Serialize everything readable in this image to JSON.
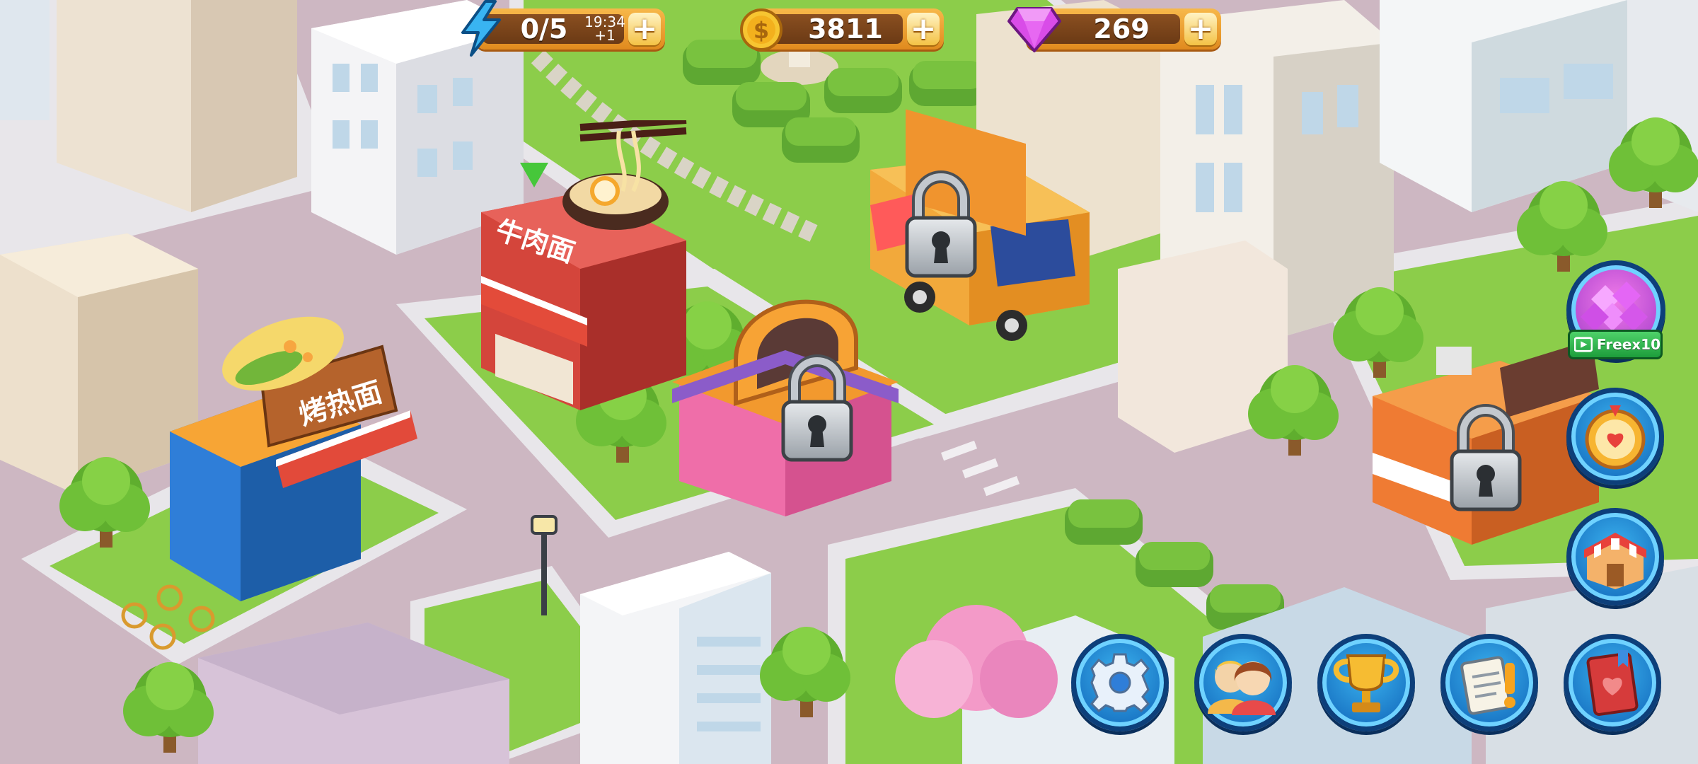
{
  "hud": {
    "energy": {
      "value": "0/5",
      "timer": "19:34",
      "regen": "+1",
      "icon": "lightning-icon",
      "plus": "+"
    },
    "coins": {
      "value": "3811",
      "icon": "coin-icon",
      "plus": "+"
    },
    "gems": {
      "value": "269",
      "icon": "gem-icon",
      "plus": "+"
    }
  },
  "restaurants": [
    {
      "sign": "烤热面",
      "status": "unlocked"
    },
    {
      "sign": "牛肉面",
      "status": "unlocked"
    },
    {
      "sign": "",
      "status": "locked"
    },
    {
      "sign": "",
      "status": "locked"
    },
    {
      "sign": "",
      "status": "locked"
    }
  ],
  "side_buttons": {
    "gems_reward": {
      "label": "Freex10",
      "icon": "gem-pile-icon",
      "badge_icon": "video-ad-icon"
    },
    "wheel": {
      "icon": "prize-wheel-icon"
    },
    "shop": {
      "icon": "shop-icon"
    }
  },
  "bottom_buttons": [
    {
      "name": "settings",
      "icon": "gear-icon"
    },
    {
      "name": "friends",
      "icon": "friends-icon"
    },
    {
      "name": "trophy",
      "icon": "trophy-icon"
    },
    {
      "name": "tasks",
      "icon": "notepad-icon"
    },
    {
      "name": "recipes",
      "icon": "recipe-book-icon"
    }
  ],
  "colors": {
    "road": "#c9b4bf",
    "grass": "#8ccd4a",
    "hud_orange": "#f0a032",
    "button_blue": "#1b79c7",
    "lock_gray": "#c8cdd2"
  }
}
